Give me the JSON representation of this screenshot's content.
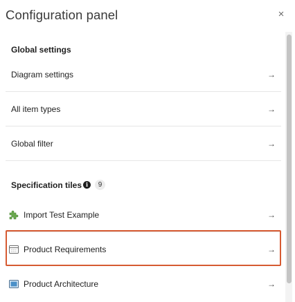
{
  "panel": {
    "title": "Configuration panel",
    "close_label": "×"
  },
  "global": {
    "heading": "Global settings",
    "items": [
      {
        "label": "Diagram settings",
        "arrow": "→"
      },
      {
        "label": "All item types",
        "arrow": "→"
      },
      {
        "label": "Global filter",
        "arrow": "→"
      }
    ]
  },
  "tiles": {
    "heading": "Specification tiles",
    "info_glyph": "i",
    "count": "9",
    "items": [
      {
        "label": "Import Test Example",
        "icon": "puzzle-piece-icon",
        "arrow": "→"
      },
      {
        "label": "Product Requirements",
        "icon": "table-window-icon",
        "arrow": "→",
        "highlighted": true
      },
      {
        "label": "Product Architecture",
        "icon": "image-frame-icon",
        "arrow": "→"
      }
    ]
  },
  "colors": {
    "highlight": "#d65a31",
    "puzzle_icon": "#6aa84f",
    "architecture_icon": "#4a90c8"
  }
}
